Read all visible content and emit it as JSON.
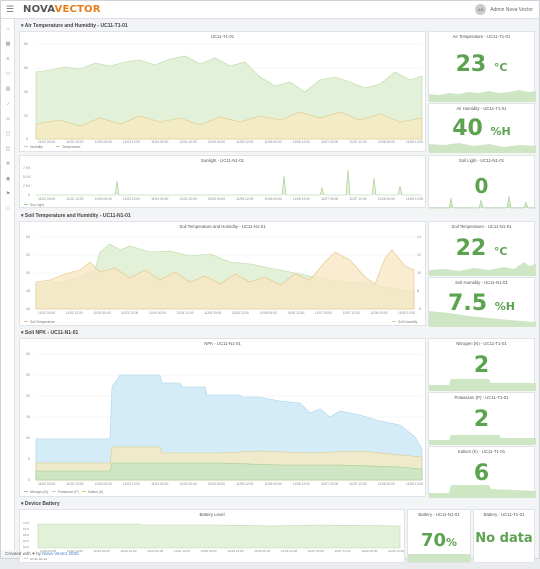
{
  "app": {
    "brand_a": "NOVA",
    "brand_b": "VECTOR",
    "user_initials": "AN",
    "user_name": "Admin Nova Vector"
  },
  "sidebar": [
    "home-icon",
    "grid-icon",
    "layers-icon",
    "device-icon",
    "chart-icon",
    "bell-icon",
    "user-icon",
    "folder-icon",
    "box-icon",
    "settings-icon",
    "map-icon",
    "flag-icon",
    "info-icon"
  ],
  "sections": {
    "air": "Air Temperature and Humidity - UC11-T1-01",
    "soil": "Soil Temperature and Humidity - UC11-N1-01",
    "npk": "Soil NPK - UC11-N1-01",
    "battery": "Device Battery"
  },
  "colors": {
    "green": "#5ba34f",
    "humidity_fill": "#dff0d3",
    "temp_fill": "#f5e9c5",
    "npk_n": "#cfe8f5"
  },
  "panels": {
    "air_chart": {
      "title": "UC11-T1-01",
      "legend": [
        "Humidity",
        "Temperature"
      ],
      "x_ticks": [
        "11/02 00:00",
        "11/02 12:00",
        "11/03 00:00",
        "11/03 12:00",
        "11/04 00:00",
        "11/04 12:00",
        "11/05 00:00",
        "11/05 12:00",
        "11/06 00:00",
        "11/06 12:00",
        "11/07 00:00",
        "11/07 12:00",
        "11/08 00:00",
        "11/08 12:00"
      ],
      "y_ticks": [
        "80",
        "60",
        "40",
        "20",
        "0"
      ]
    },
    "sun_chart": {
      "title": "Sunlight - UC11-N1-01",
      "legend": [
        "Sun Light"
      ],
      "y_ticks": [
        "7.5 K",
        "5.0 K",
        "2.5 K",
        "0"
      ],
      "x_ticks": [
        "11/02 00:00",
        "11/02 12:00",
        "11/03 00:00",
        "11/03 12:00",
        "11/04 00:00",
        "11/04 12:00",
        "11/05 00:00",
        "11/05 12:00",
        "11/06 00:00",
        "11/06 12:00",
        "11/07 00:00",
        "11/07 12:00",
        "11/08 00:00",
        "11/08 12:00"
      ]
    },
    "air_temp": {
      "title": "Air Temperature - UC11-T1-01",
      "value": "23",
      "unit": "°C"
    },
    "air_hum": {
      "title": "Air Humidity - UC11-T1-01",
      "value": "40",
      "unit": "%H"
    },
    "soil_light": {
      "title": "Soil Light - UC11-N1-01",
      "value": "0"
    },
    "soil_chart": {
      "title": "Soil Temperature and Humidity - UC11-N1-01",
      "legend_l": [
        "Soil Temperature"
      ],
      "legend_r": [
        "Soil Humidity"
      ],
      "y_ticks_l": [
        "24",
        "22",
        "20",
        "18",
        "16"
      ],
      "y_ticks_r": [
        "14",
        "12",
        "10",
        "8",
        "6"
      ],
      "x_ticks": [
        "11/02 00:00",
        "11/02 12:00",
        "11/03 00:00",
        "11/03 12:00",
        "11/04 00:00",
        "11/04 12:00",
        "11/05 00:00",
        "11/05 12:00",
        "11/06 00:00",
        "11/06 12:00",
        "11/07 00:00",
        "11/07 12:00",
        "11/08 00:00",
        "11/08 12:00"
      ]
    },
    "soil_temp": {
      "title": "Soil Temperature - UC11-N1-01",
      "value": "22",
      "unit": "°C"
    },
    "soil_hum": {
      "title": "Soil Humidity - UC11-N1-01",
      "value": "7.5",
      "unit": "%H"
    },
    "npk_chart": {
      "title": "NPK - UC11-N1-01",
      "legend": [
        "Nitrogen (N)",
        "Potassium (P)",
        "Kalium (K)"
      ],
      "y_ticks": [
        "30",
        "25",
        "20",
        "15",
        "10",
        "5",
        "0"
      ],
      "x_ticks": [
        "11/02 00:00",
        "11/02 12:00",
        "11/03 00:00",
        "11/03 12:00",
        "11/04 00:00",
        "11/04 12:00",
        "11/05 00:00",
        "11/05 12:00",
        "11/06 00:00",
        "11/06 12:00",
        "11/07 00:00",
        "11/07 12:00",
        "11/08 00:00",
        "11/08 12:00"
      ]
    },
    "nitrogen": {
      "title": "Nitrogen (N) - UC11-T1-01",
      "value": "2"
    },
    "potassium": {
      "title": "Potassium (P) - UC11-T1-01",
      "value": "2"
    },
    "kalium": {
      "title": "Kalium (K) - UC11-T1-01",
      "value": "6"
    },
    "battery_chart": {
      "title": "Battery Level",
      "legend": [
        "UC11-N1-01"
      ],
      "y_ticks": [
        "70.0",
        "67.5",
        "65.0",
        "62.5",
        "60.0"
      ],
      "x_ticks": [
        "11/02 00:00",
        "11/02 12:00",
        "11/03 00:00",
        "11/03 12:00",
        "11/04 00:00",
        "11/04 12:00",
        "11/05 00:00",
        "11/05 12:00",
        "11/06 00:00",
        "11/06 12:00",
        "11/07 00:00",
        "11/07 12:00",
        "11/08 00:00",
        "11/08 12:00"
      ]
    },
    "battery_n1": {
      "title": "Battery - UC11-N1-01",
      "value": "70",
      "unit": "%"
    },
    "battery_t1": {
      "title": "Battery - UC11-T1-01",
      "value": "No data"
    }
  },
  "footer": {
    "prefix": "Created with ♥ by",
    "link": "Nova Vector 2020"
  }
}
